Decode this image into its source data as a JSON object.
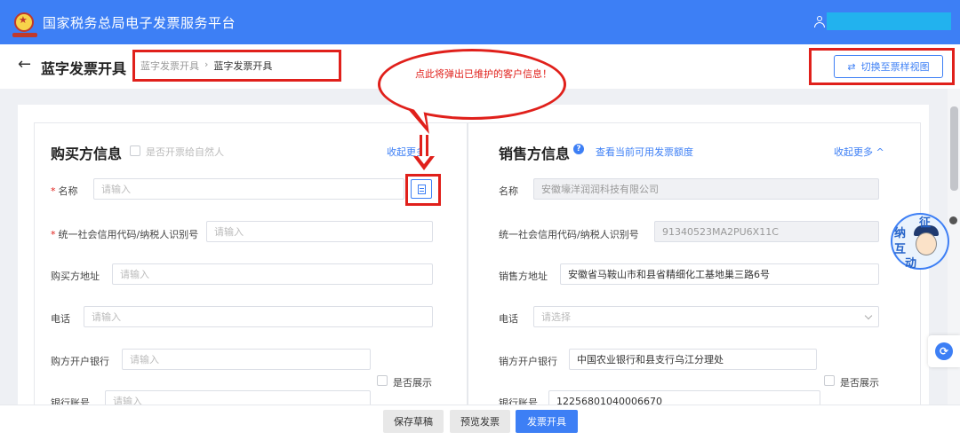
{
  "app": {
    "title": "国家税务总局电子发票服务平台",
    "logo_icon": "emblem-icon",
    "user_icon": "user-icon"
  },
  "header": {
    "back_icon": "arrow-left-icon",
    "back_glyph": "←",
    "page_title": "蓝字发票开具",
    "breadcrumb": [
      "蓝字发票开具",
      "蓝字发票开具"
    ],
    "breadcrumb_sep": "›",
    "switch_icon": "swap-icon",
    "switch_glyph": "⇄",
    "switch_label": "切换至票样视图"
  },
  "annotation": {
    "callout_text": "点此将弹出已维护的客户信息！"
  },
  "buyer": {
    "title": "购买方信息",
    "natural_person_label": "是否开票给自然人",
    "collapse_link": "收起更多",
    "name_label": "名称",
    "name_placeholder": "请输入",
    "tax_id_label": "统一社会信用代码/纳税人识别号",
    "tax_id_placeholder": "请输入",
    "address_label": "购买方地址",
    "address_placeholder": "请输入",
    "phone_label": "电话",
    "phone_placeholder": "请输入",
    "bank_label": "购方开户银行",
    "bank_placeholder": "请输入",
    "show_label": "是否展示",
    "account_label": "银行账号",
    "account_placeholder": "请输入",
    "required_mark": "*"
  },
  "seller": {
    "title": "销售方信息",
    "help_glyph": "?",
    "quota_link": "查看当前可用发票额度",
    "collapse_link": "收起更多 ^",
    "name_label": "名称",
    "name_value": "安徽壕洋润润科技有限公司",
    "tax_id_label": "统一社会信用代码/纳税人识别号",
    "tax_id_value": "91340523MA2PU6X11C",
    "address_label": "销售方地址",
    "address_value": "安徽省马鞍山市和县省精细化工基地巢三路6号",
    "phone_label": "电话",
    "phone_placeholder": "请选择",
    "bank_label": "销方开户银行",
    "bank_value": "中国农业银行和县支行乌江分理处",
    "show_label": "是否展示",
    "account_label": "银行账号",
    "account_value": "12256801040006670"
  },
  "mascot": {
    "chars": [
      "征",
      "纳",
      "互",
      "动"
    ]
  },
  "float_icon_glyph": "⟳",
  "footer": {
    "save_draft": "保存草稿",
    "preview": "预览发票",
    "issue": "发票开具"
  },
  "colors": {
    "primary": "#3d7ff5",
    "annotation_red": "#e0201b"
  }
}
